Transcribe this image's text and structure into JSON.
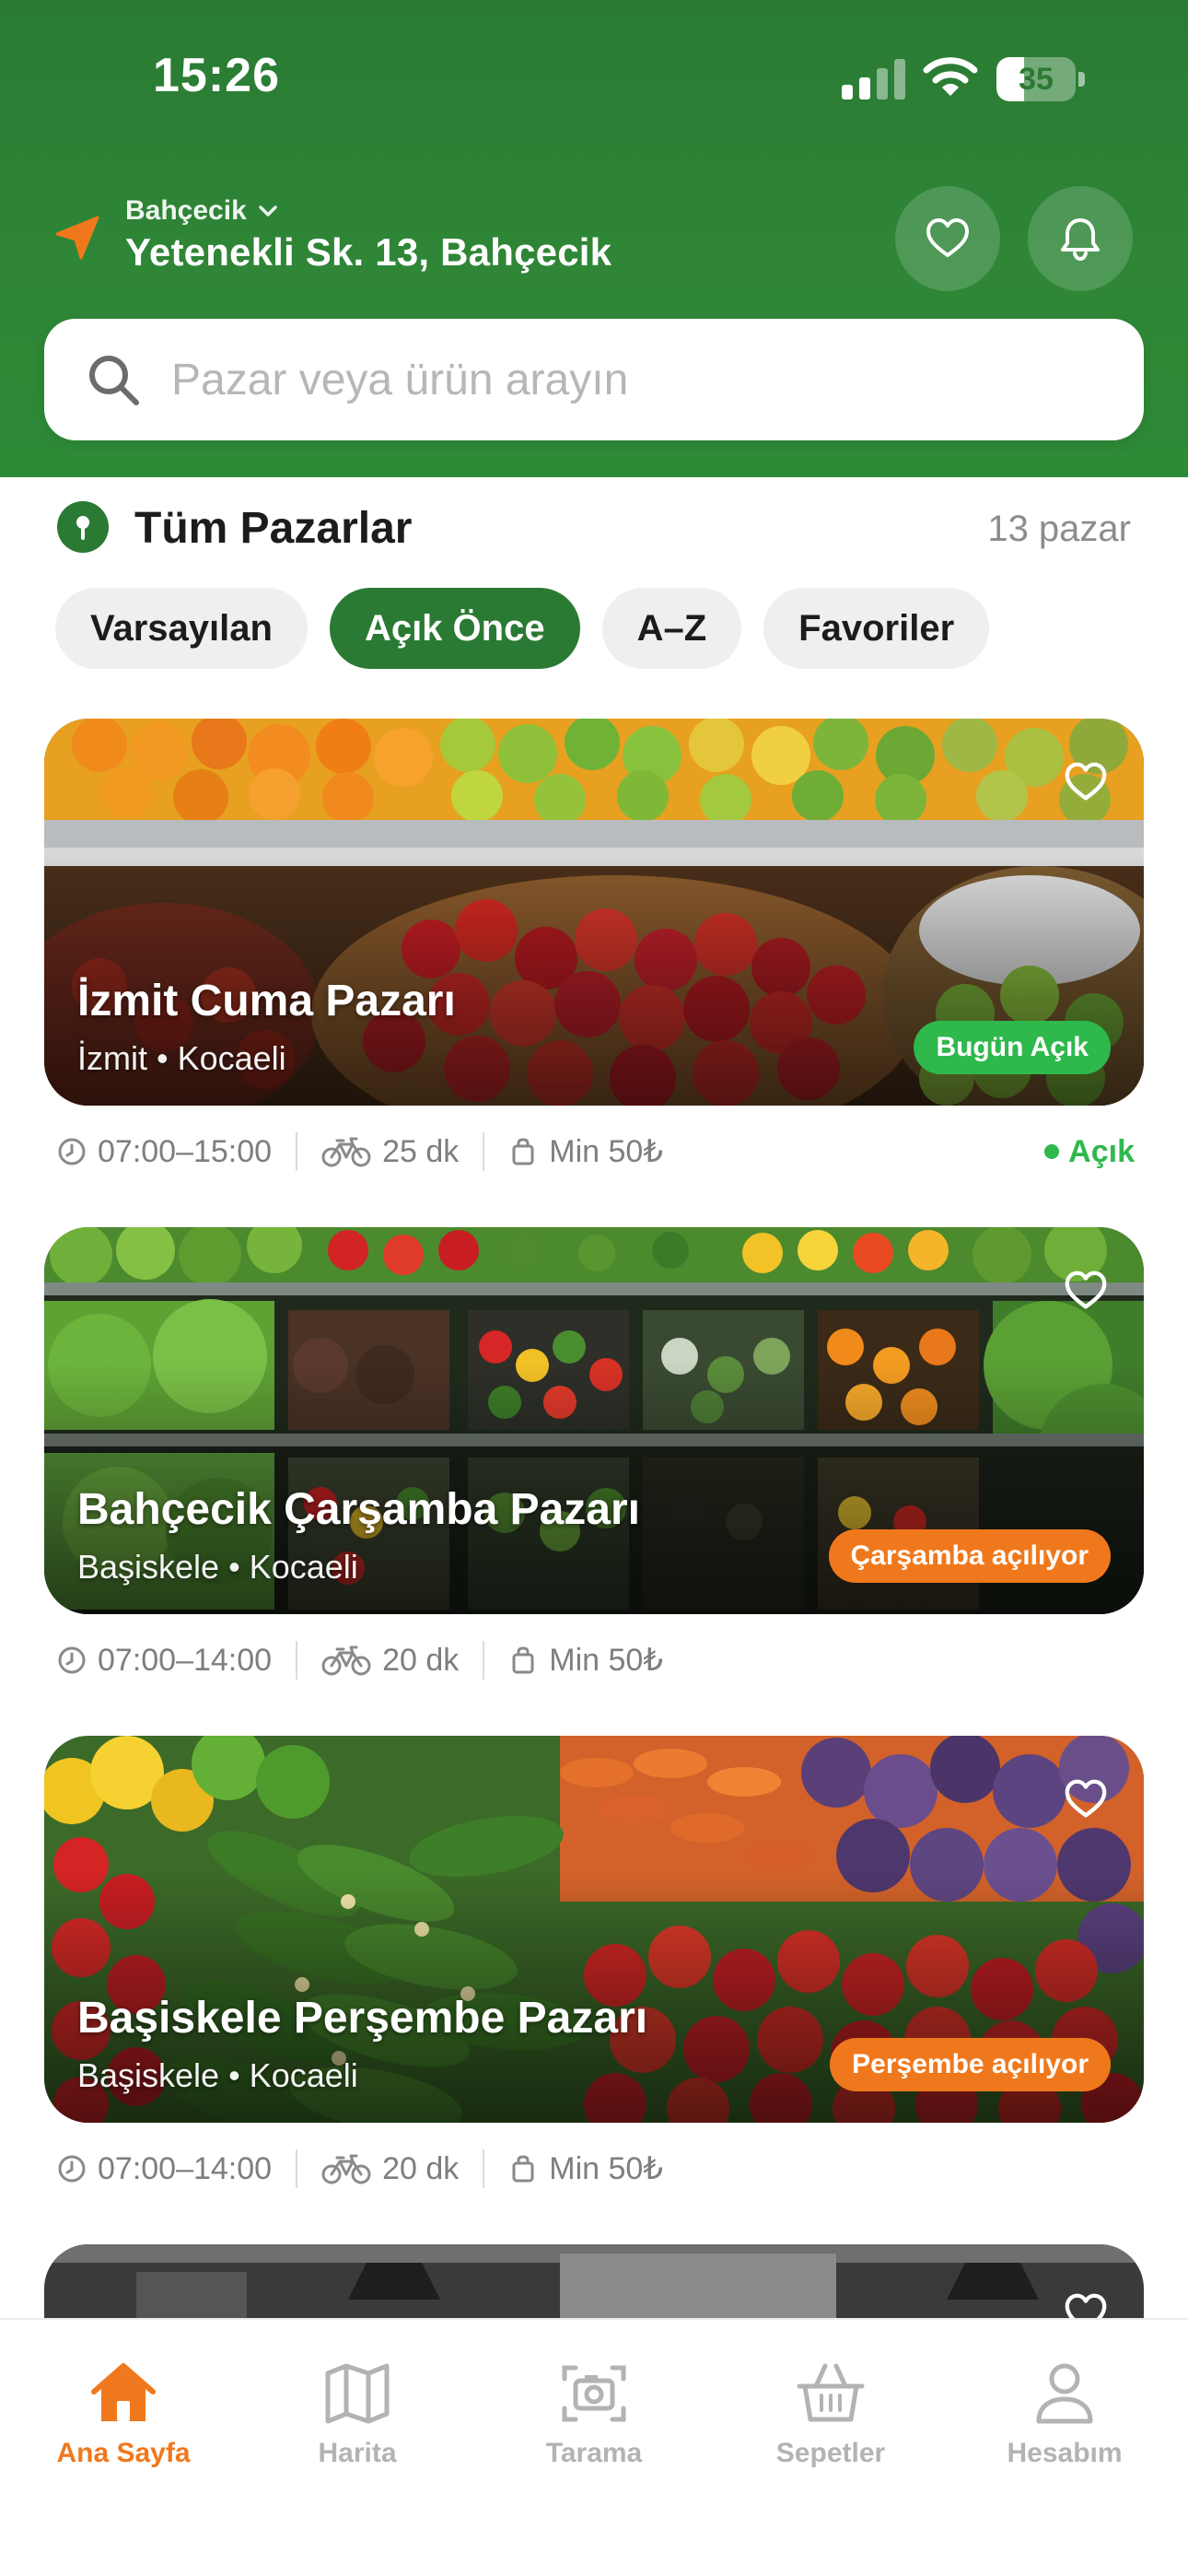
{
  "status_bar": {
    "time": "15:26",
    "battery": "35"
  },
  "header": {
    "location_label": "Bahçecik",
    "address": "Yetenekli Sk. 13, Bahçecik",
    "search_placeholder": "Pazar veya ürün arayın"
  },
  "section": {
    "title": "Tüm Pazarlar",
    "count": "13 pazar",
    "chips": [
      {
        "label": "Varsayılan",
        "active": false
      },
      {
        "label": "Açık Önce",
        "active": true
      },
      {
        "label": "A–Z",
        "active": false
      },
      {
        "label": "Favoriler",
        "active": false
      }
    ]
  },
  "markets": [
    {
      "name": "İzmit Cuma Pazarı",
      "location": "İzmit • Kocaeli",
      "badge": "Bugün Açık",
      "hours": "07:00–15:00",
      "delivery": "25 dk",
      "min_order": "Min 50₺",
      "status": "Açık"
    },
    {
      "name": "Bahçecik Çarşamba Pazarı",
      "location": "Başiskele • Kocaeli",
      "badge": "Çarşamba açılıyor",
      "hours": "07:00–14:00",
      "delivery": "20 dk",
      "min_order": "Min 50₺"
    },
    {
      "name": "Başiskele Perşembe Pazarı",
      "location": "Başiskele • Kocaeli",
      "badge": "Perşembe açılıyor",
      "hours": "07:00–14:00",
      "delivery": "20 dk",
      "min_order": "Min 50₺"
    }
  ],
  "tabbar": [
    {
      "label": "Ana Sayfa",
      "icon": "home-icon",
      "active": true
    },
    {
      "label": "Harita",
      "icon": "map-icon",
      "active": false
    },
    {
      "label": "Tarama",
      "icon": "scan-icon",
      "active": false
    },
    {
      "label": "Sepetler",
      "icon": "basket-icon",
      "active": false
    },
    {
      "label": "Hesabım",
      "icon": "person-icon",
      "active": false
    }
  ],
  "colors": {
    "brand_green": "#2a7a33",
    "accent_orange": "#f0781c",
    "open_green": "#2fb84c"
  }
}
